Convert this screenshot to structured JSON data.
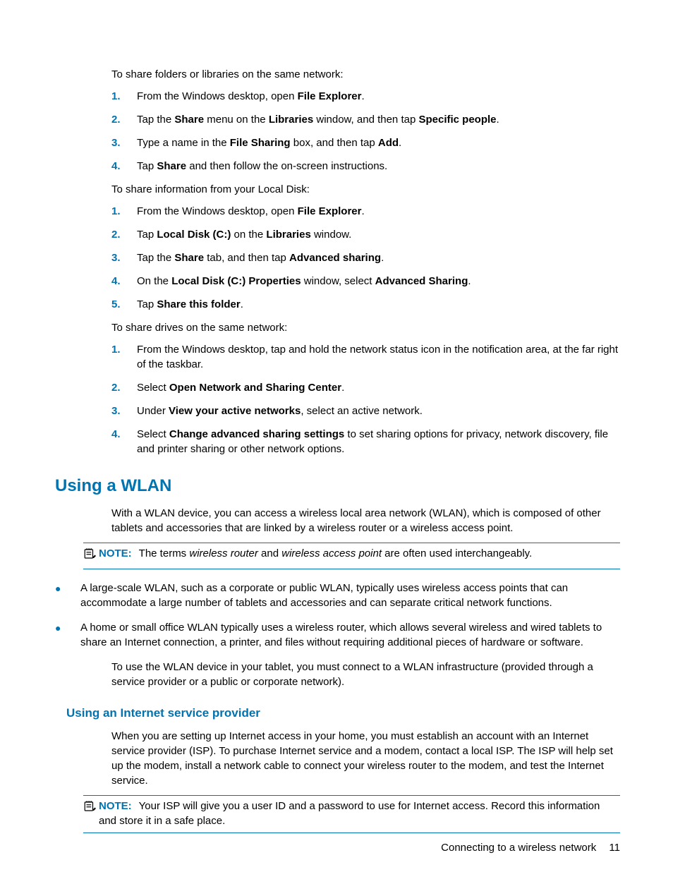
{
  "intro1": "To share folders or libraries on the same network:",
  "list1": [
    {
      "pre": "From the Windows desktop, open ",
      "b1": "File Explorer",
      "post": "."
    },
    {
      "pre": "Tap the ",
      "b1": "Share",
      "mid1": " menu on the ",
      "b2": "Libraries",
      "mid2": " window, and then tap ",
      "b3": "Specific people",
      "post": "."
    },
    {
      "pre": "Type a name in the ",
      "b1": "File Sharing",
      "mid1": " box, and then tap ",
      "b2": "Add",
      "post": "."
    },
    {
      "pre": "Tap ",
      "b1": "Share",
      "post": " and then follow the on-screen instructions."
    }
  ],
  "intro2": "To share information from your Local Disk:",
  "list2": [
    {
      "pre": "From the Windows desktop, open ",
      "b1": "File Explorer",
      "post": "."
    },
    {
      "pre": "Tap ",
      "b1": "Local Disk (C:)",
      "mid1": " on the ",
      "b2": "Libraries",
      "post": " window."
    },
    {
      "pre": "Tap the ",
      "b1": "Share",
      "mid1": " tab, and then tap ",
      "b2": "Advanced sharing",
      "post": "."
    },
    {
      "pre": "On the ",
      "b1": "Local Disk (C:) Properties",
      "mid1": " window, select ",
      "b2": "Advanced Sharing",
      "post": "."
    },
    {
      "pre": "Tap ",
      "b1": "Share this folder",
      "post": "."
    }
  ],
  "intro3": "To share drives on the same network:",
  "list3": [
    {
      "pre": "From the Windows desktop, tap and hold the network status icon in the notification area, at the far right of the taskbar."
    },
    {
      "pre": "Select ",
      "b1": "Open Network and Sharing Center",
      "post": "."
    },
    {
      "pre": "Under ",
      "b1": "View your active networks",
      "post": ", select an active network."
    },
    {
      "pre": "Select ",
      "b1": "Change advanced sharing settings",
      "post": " to set sharing options for privacy, network discovery, file and printer sharing or other network options."
    }
  ],
  "h2_wlan": "Using a WLAN",
  "wlan_p1": "With a WLAN device, you can access a wireless local area network (WLAN), which is composed of other tablets and accessories that are linked by a wireless router or a wireless access point.",
  "note1": {
    "label": "NOTE:",
    "pre": "The terms ",
    "i1": "wireless router",
    "mid": " and ",
    "i2": "wireless access point",
    "post": " are often used interchangeably."
  },
  "wlan_bullets": [
    "A large-scale WLAN, such as a corporate or public WLAN, typically uses wireless access points that can accommodate a large number of tablets and accessories and can separate critical network functions.",
    "A home or small office WLAN typically uses a wireless router, which allows several wireless and wired tablets to share an Internet connection, a printer, and files without requiring additional pieces of hardware or software."
  ],
  "wlan_p2": "To use the WLAN device in your tablet, you must connect to a WLAN infrastructure (provided through a service provider or a public or corporate network).",
  "h3_isp": "Using an Internet service provider",
  "isp_p1": "When you are setting up Internet access in your home, you must establish an account with an Internet service provider (ISP). To purchase Internet service and a modem, contact a local ISP. The ISP will help set up the modem, install a network cable to connect your wireless router to the modem, and test the Internet service.",
  "note2": {
    "label": "NOTE:",
    "text": "Your ISP will give you a user ID and a password to use for Internet access. Record this information and store it in a safe place."
  },
  "footer": {
    "text": "Connecting to a wireless network",
    "page": "11"
  }
}
